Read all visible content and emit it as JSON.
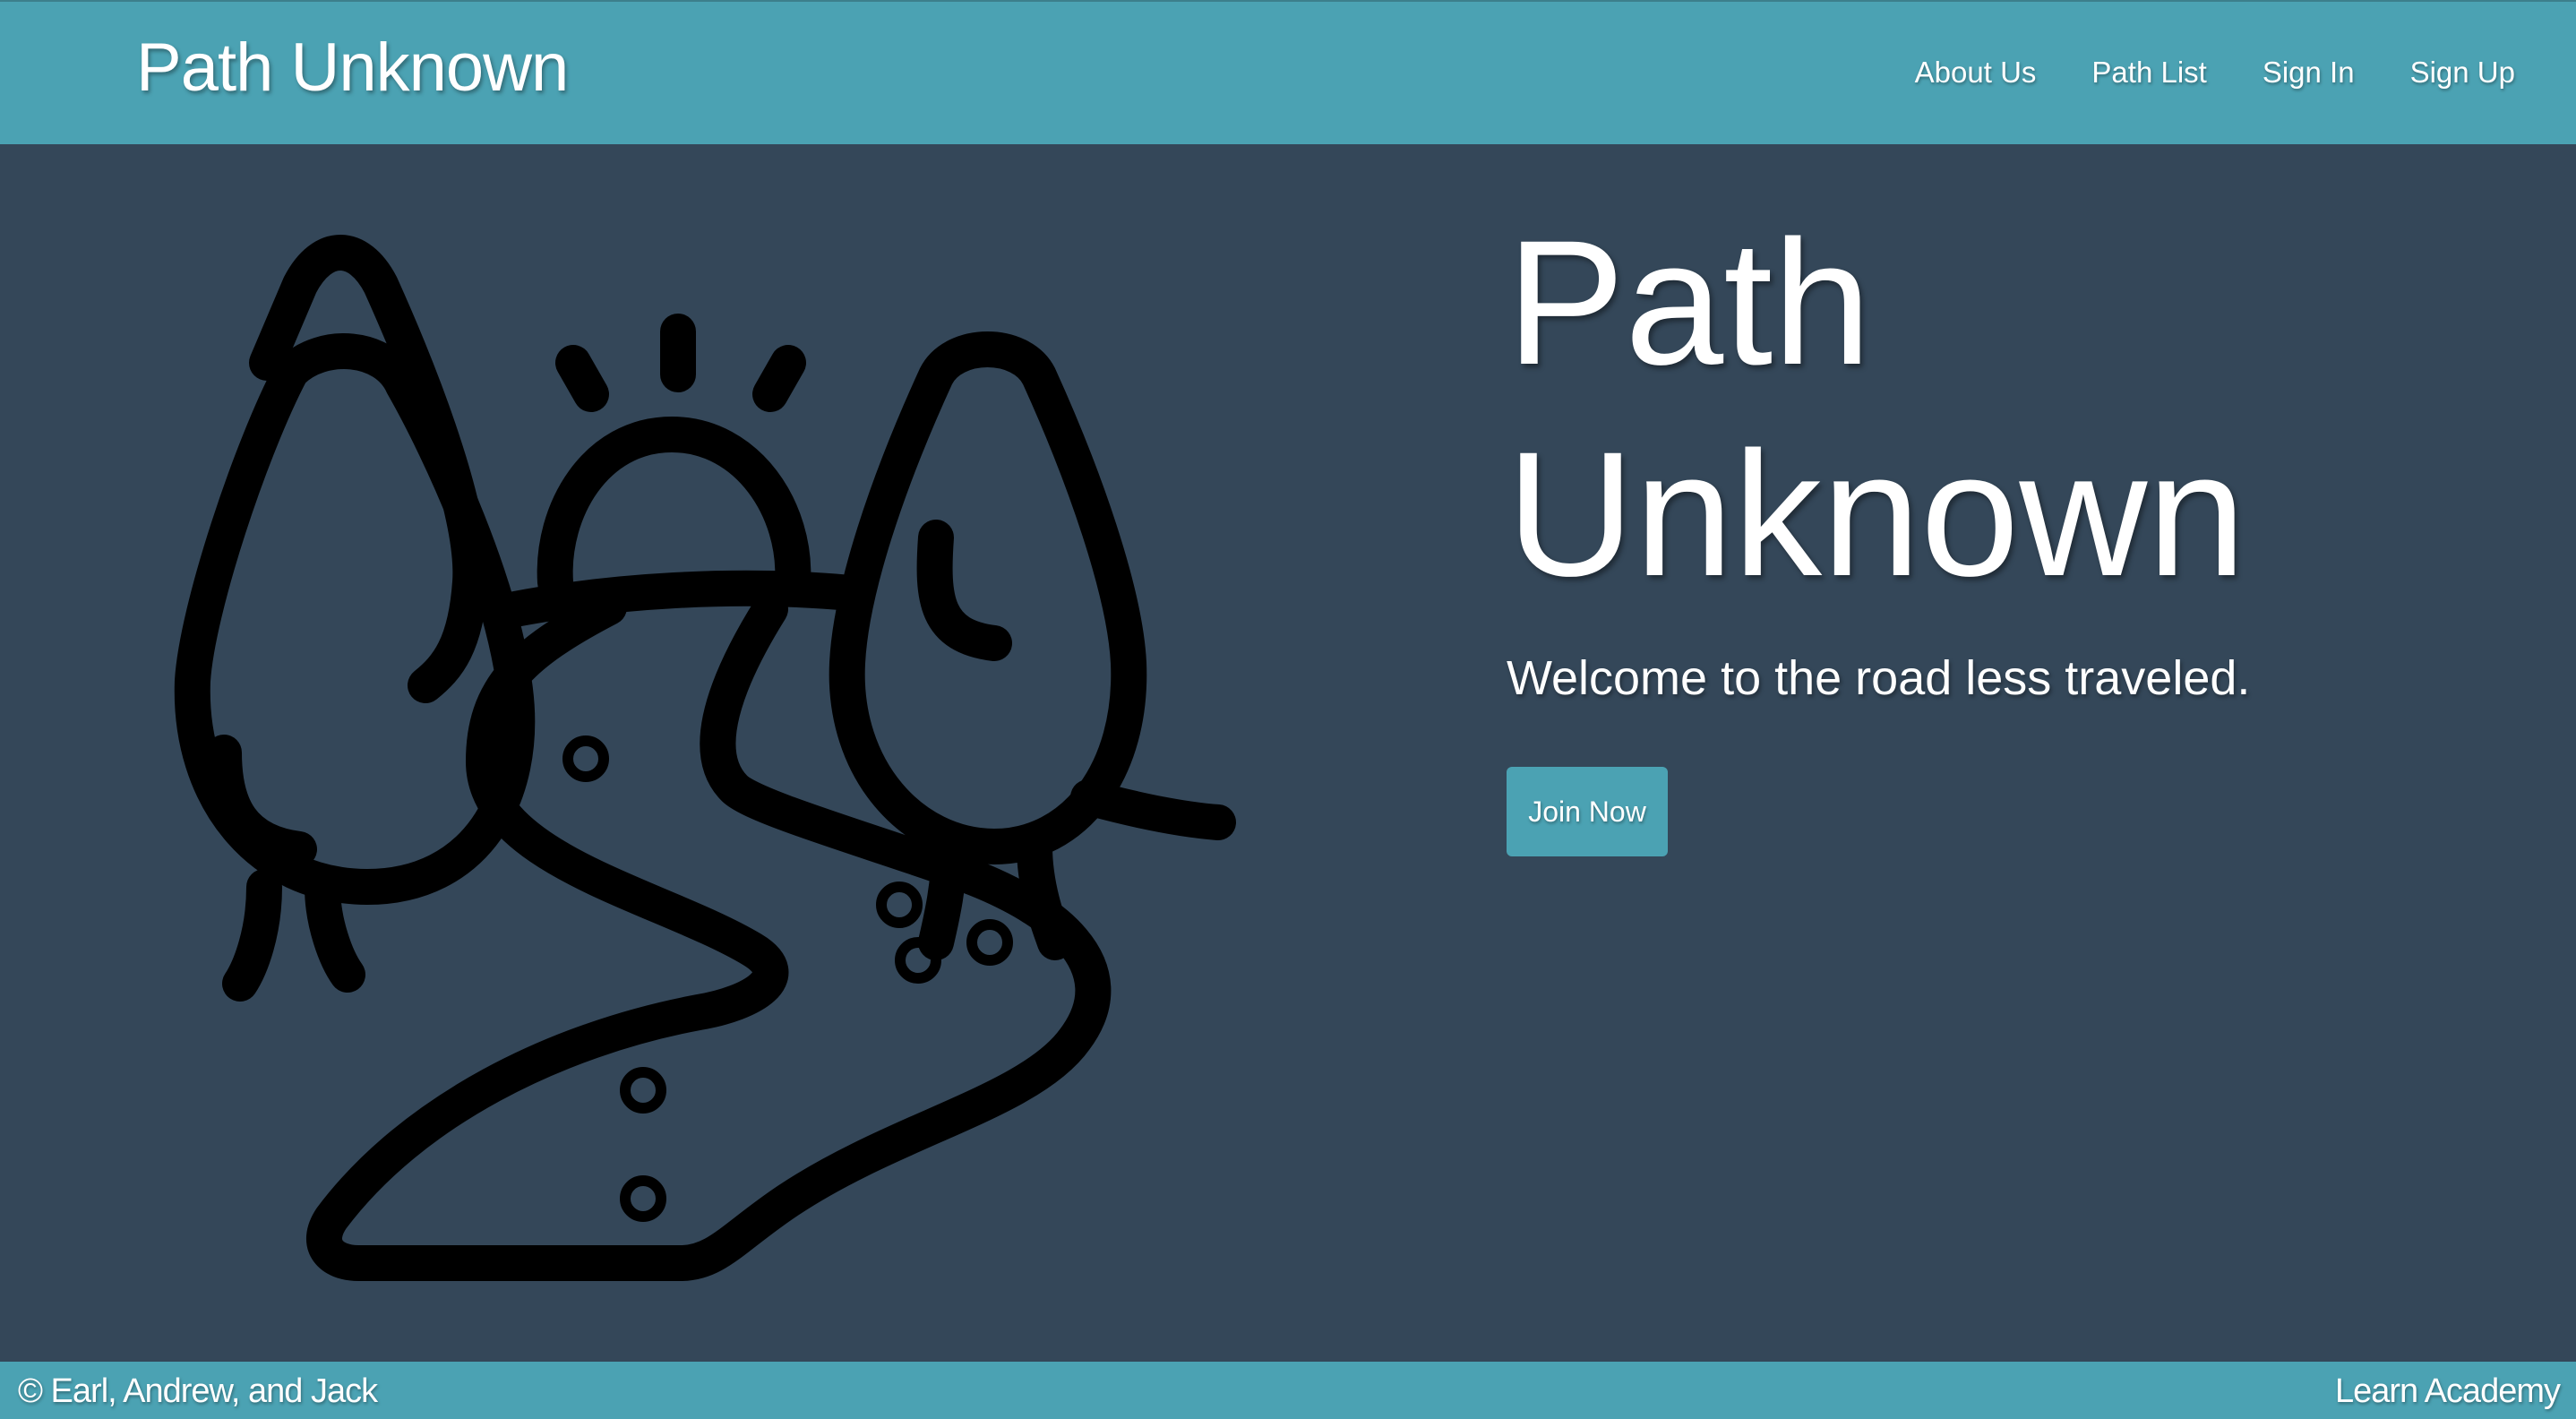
{
  "navbar": {
    "brand": "Path Unknown",
    "links": [
      {
        "label": "About Us"
      },
      {
        "label": "Path List"
      },
      {
        "label": "Sign In"
      },
      {
        "label": "Sign Up"
      }
    ]
  },
  "hero": {
    "title_line1": "Path",
    "title_line2": "Unknown",
    "subtitle": "Welcome to the road less traveled.",
    "cta_label": "Join Now",
    "illustration_icon": "path-trees-sun-icon"
  },
  "footer": {
    "left_text": "© Earl, Andrew, and Jack",
    "right_text": "Learn Academy"
  },
  "colors": {
    "navbar_bg": "#4ba2b3",
    "page_bg": "#344759",
    "button_bg": "#4ba2b3",
    "text": "#ffffff",
    "illustration_stroke": "#000000"
  }
}
